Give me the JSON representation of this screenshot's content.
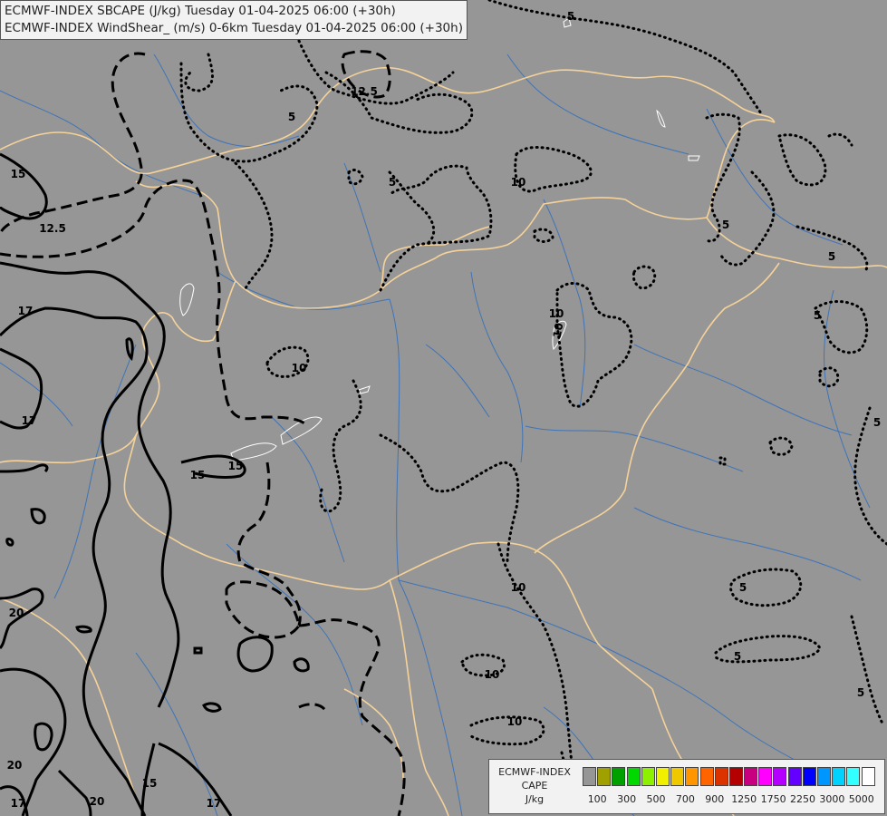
{
  "header": {
    "line1": "ECMWF-INDEX SBCAPE (J/kg) Tuesday 01-04-2025 06:00 (+30h)",
    "line2": "ECMWF-INDEX WindShear_ (m/s) 0-6km Tuesday 01-04-2025 06:00 (+30h)"
  },
  "legend": {
    "line1": "ECMWF-INDEX",
    "line2": "CAPE",
    "line3": "J/kg",
    "colors": [
      "#969696",
      "#a0a000",
      "#00a000",
      "#00d800",
      "#8cf000",
      "#f0f000",
      "#f0c800",
      "#ff9600",
      "#ff6400",
      "#dc3200",
      "#b40000",
      "#c80080",
      "#ff00ff",
      "#b400ff",
      "#6400ff",
      "#0000ff",
      "#0096ff",
      "#00d2ff",
      "#32ffff",
      "#ffffff"
    ],
    "ticks": [
      "100",
      "300",
      "500",
      "700",
      "900",
      "1250",
      "1750",
      "2250",
      "3000",
      "5000"
    ]
  },
  "contour_labels": [
    "5",
    "5",
    "5",
    "5",
    "5",
    "5",
    "5",
    "5",
    "5",
    "5",
    "10",
    "10",
    "10",
    "10",
    "10",
    "10",
    "10",
    "12.5",
    "12.5",
    "15",
    "15",
    "15",
    "15",
    "17",
    "17",
    "17",
    "17",
    "20",
    "20",
    "20"
  ]
}
